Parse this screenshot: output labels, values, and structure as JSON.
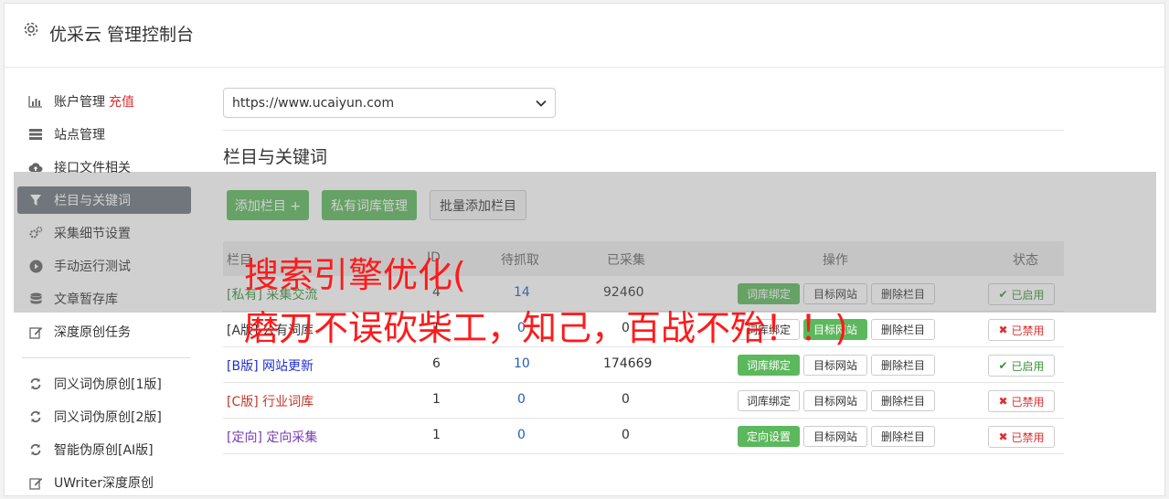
{
  "header": {
    "title": "优采云 管理控制台"
  },
  "sidebar": {
    "items": [
      {
        "label": "账户管理",
        "extra": "充值",
        "icon": "bar-chart-icon"
      },
      {
        "label": "站点管理",
        "icon": "server-icon"
      },
      {
        "label": "接口文件相关",
        "icon": "cloud-upload-icon"
      },
      {
        "label": "栏目与关键词",
        "icon": "filter-icon",
        "active": true
      },
      {
        "label": "采集细节设置",
        "icon": "cogs-icon"
      },
      {
        "label": "手动运行测试",
        "icon": "play-circle-icon"
      },
      {
        "label": "文章暂存库",
        "icon": "database-icon"
      },
      {
        "label": "深度原创任务",
        "icon": "edit-icon"
      }
    ],
    "items2": [
      {
        "label": "同义词伪原创[1版]",
        "icon": "refresh-icon"
      },
      {
        "label": "同义词伪原创[2版]",
        "icon": "refresh-icon"
      },
      {
        "label": "智能伪原创[AI版]",
        "icon": "refresh-icon"
      },
      {
        "label": "UWriter深度原创",
        "icon": "edit-icon"
      }
    ]
  },
  "site_select": {
    "value": "https://www.ucaiyun.com"
  },
  "section": {
    "title": "栏目与关键词"
  },
  "buttons": {
    "add_column": "添加栏目 +",
    "private_lexicon": "私有词库管理",
    "batch_add": "批量添加栏目"
  },
  "table": {
    "headers": {
      "col1": "栏目",
      "col2": "ID",
      "col3": "待抓取",
      "col4": "已采集",
      "col5": "操作",
      "col6": "状态"
    },
    "rows": [
      {
        "name": "[私有] 采集交流",
        "id": "4",
        "pending": "14",
        "collected": "92460",
        "op1": "词库绑定",
        "op2": "目标网站",
        "op3": "删除栏目",
        "status": "已启用"
      },
      {
        "name": "[A版] 公有词库",
        "id": "1",
        "pending": "0",
        "collected": "0",
        "op1": "词库绑定",
        "op2": "目标网站",
        "op3": "删除栏目",
        "status": "已禁用"
      },
      {
        "name": "[B版] 网站更新",
        "id": "6",
        "pending": "10",
        "collected": "174669",
        "op1": "词库绑定",
        "op2": "目标网站",
        "op3": "删除栏目",
        "status": "已启用"
      },
      {
        "name": "[C版] 行业词库",
        "id": "1",
        "pending": "0",
        "collected": "0",
        "op1": "词库绑定",
        "op2": "目标网站",
        "op3": "删除栏目",
        "status": "已禁用"
      },
      {
        "name": "[定向] 定向采集",
        "id": "1",
        "pending": "0",
        "collected": "0",
        "op1": "定向设置",
        "op2": "目标网站",
        "op3": "删除栏目",
        "status": "已禁用"
      }
    ]
  },
  "overlay": {
    "line1": "搜索引擎优化(",
    "line2": "磨刀不误砍柴工，知己，百战不殆！！)"
  },
  "colors": {
    "green": "#5cb85c",
    "red": "#d9302f",
    "active_bg": "#6c757d",
    "link_blue": "#1f5fb4",
    "private_green": "#3c8f3c",
    "c_red": "#c0392b",
    "dir_purple": "#7a3bb5",
    "overlay_red": "#ff1a1a"
  }
}
